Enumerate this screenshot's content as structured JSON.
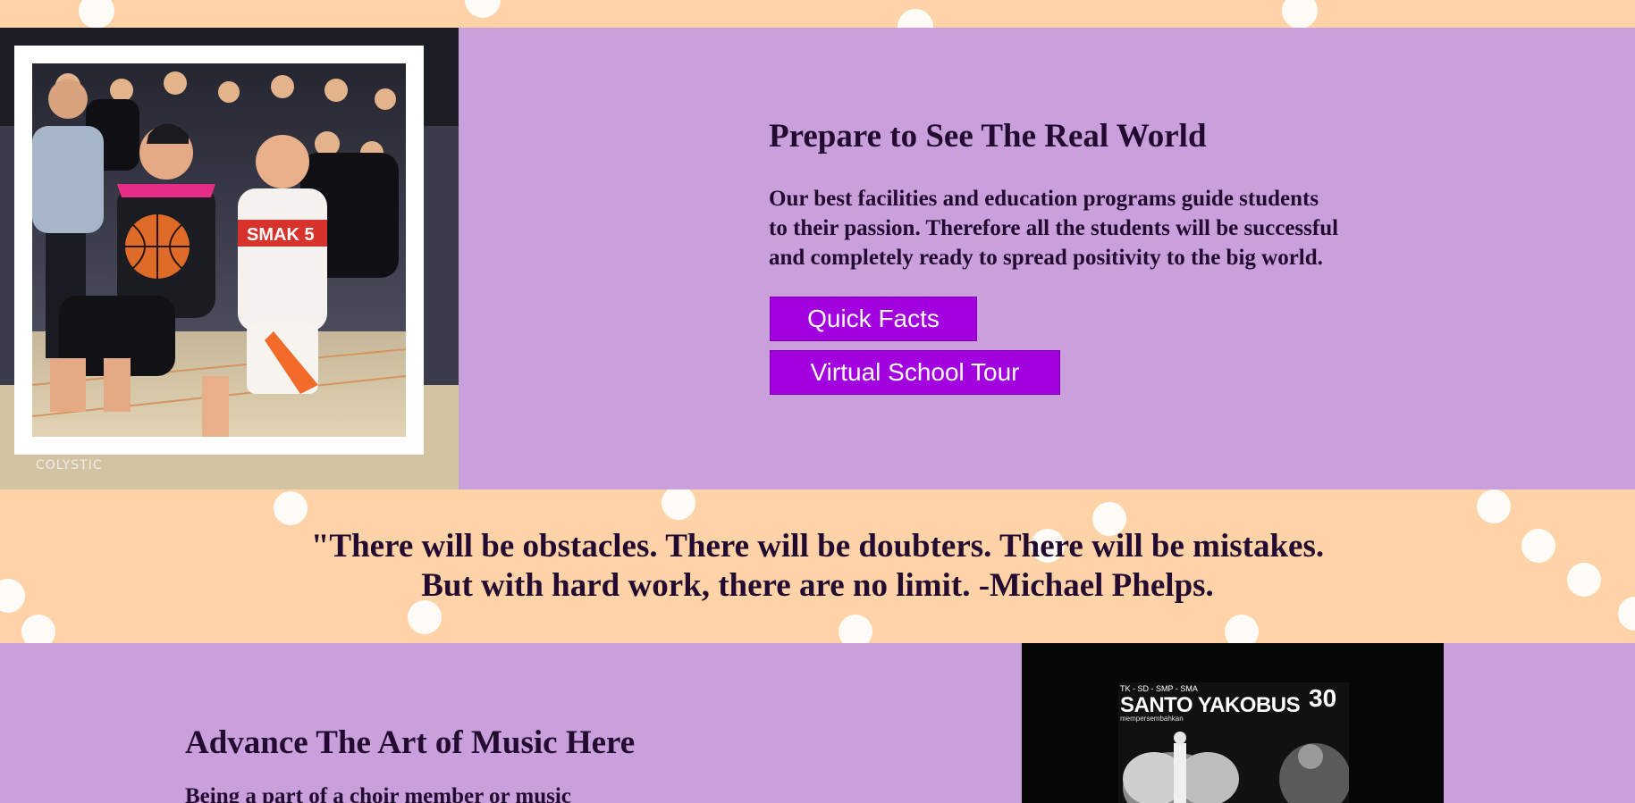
{
  "hero": {
    "photo_watermark": "COLYSTIC",
    "jersey_text": "SMAK 5",
    "heading": "Prepare to See The Real World",
    "paragraph_lines": [
      "Our best facilities and education programs guide students",
      "to their passion. Therefore all the students will be successful",
      "and completely ready to spread positivity to the big world."
    ],
    "quick_facts_label": "Quick Facts",
    "virtual_tour_label": "Virtual School Tour"
  },
  "quote": {
    "line1": "\"There will be obstacles. There will be doubters. There will be mistakes.",
    "line2": "But with hard work, there are no limit. -Michael Phelps."
  },
  "music": {
    "heading": "Advance The Art of Music Here",
    "paragraph_start": "Being a part of a choir member or music",
    "poster_levels": "TK - SD - SMP - SMA",
    "poster_title": "SANTO YAKOBUS",
    "poster_sub": "mempersembahkan",
    "poster_anniversary": "30"
  },
  "colors": {
    "peach_background": "#ffd3a8",
    "lavender_section": "#c9a0dc",
    "button_purple": "#a300e0",
    "text_dark": "#230a30"
  }
}
